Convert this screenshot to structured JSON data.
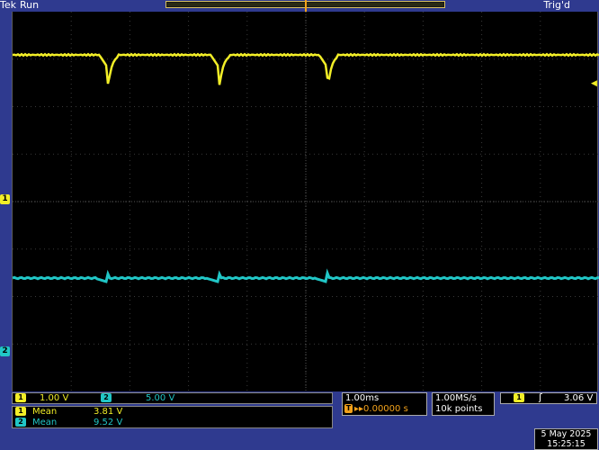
{
  "status": {
    "brand": "Tek",
    "run_state": "Run",
    "trigger_status": "Trig'd"
  },
  "channels": {
    "ch1": {
      "number": "1",
      "scale": "1.00 V",
      "color": "#f2ee27"
    },
    "ch2": {
      "number": "2",
      "scale": "5.00 V",
      "color": "#21c6c6"
    }
  },
  "measurements": [
    {
      "channel": "1",
      "label": "Mean",
      "value": "3.81 V"
    },
    {
      "channel": "2",
      "label": "Mean",
      "value": "9.52 V"
    }
  ],
  "horizontal": {
    "timebase": "1.00ms",
    "trigger_position": "▸▸0.00000 s",
    "sample_rate": "1.00MS/s",
    "record_length": "10k points"
  },
  "trigger": {
    "source": "1",
    "slope_icon": "rising-edge",
    "level": "3.06 V",
    "marker": "T"
  },
  "datetime": {
    "date": "5 May 2025",
    "time": "15:25:15"
  },
  "waveform_notes": {
    "ch1_dip_times_div": [
      1.6,
      3.5,
      5.35
    ],
    "ch2_bump_times_div": [
      1.6,
      3.5,
      5.35
    ]
  }
}
